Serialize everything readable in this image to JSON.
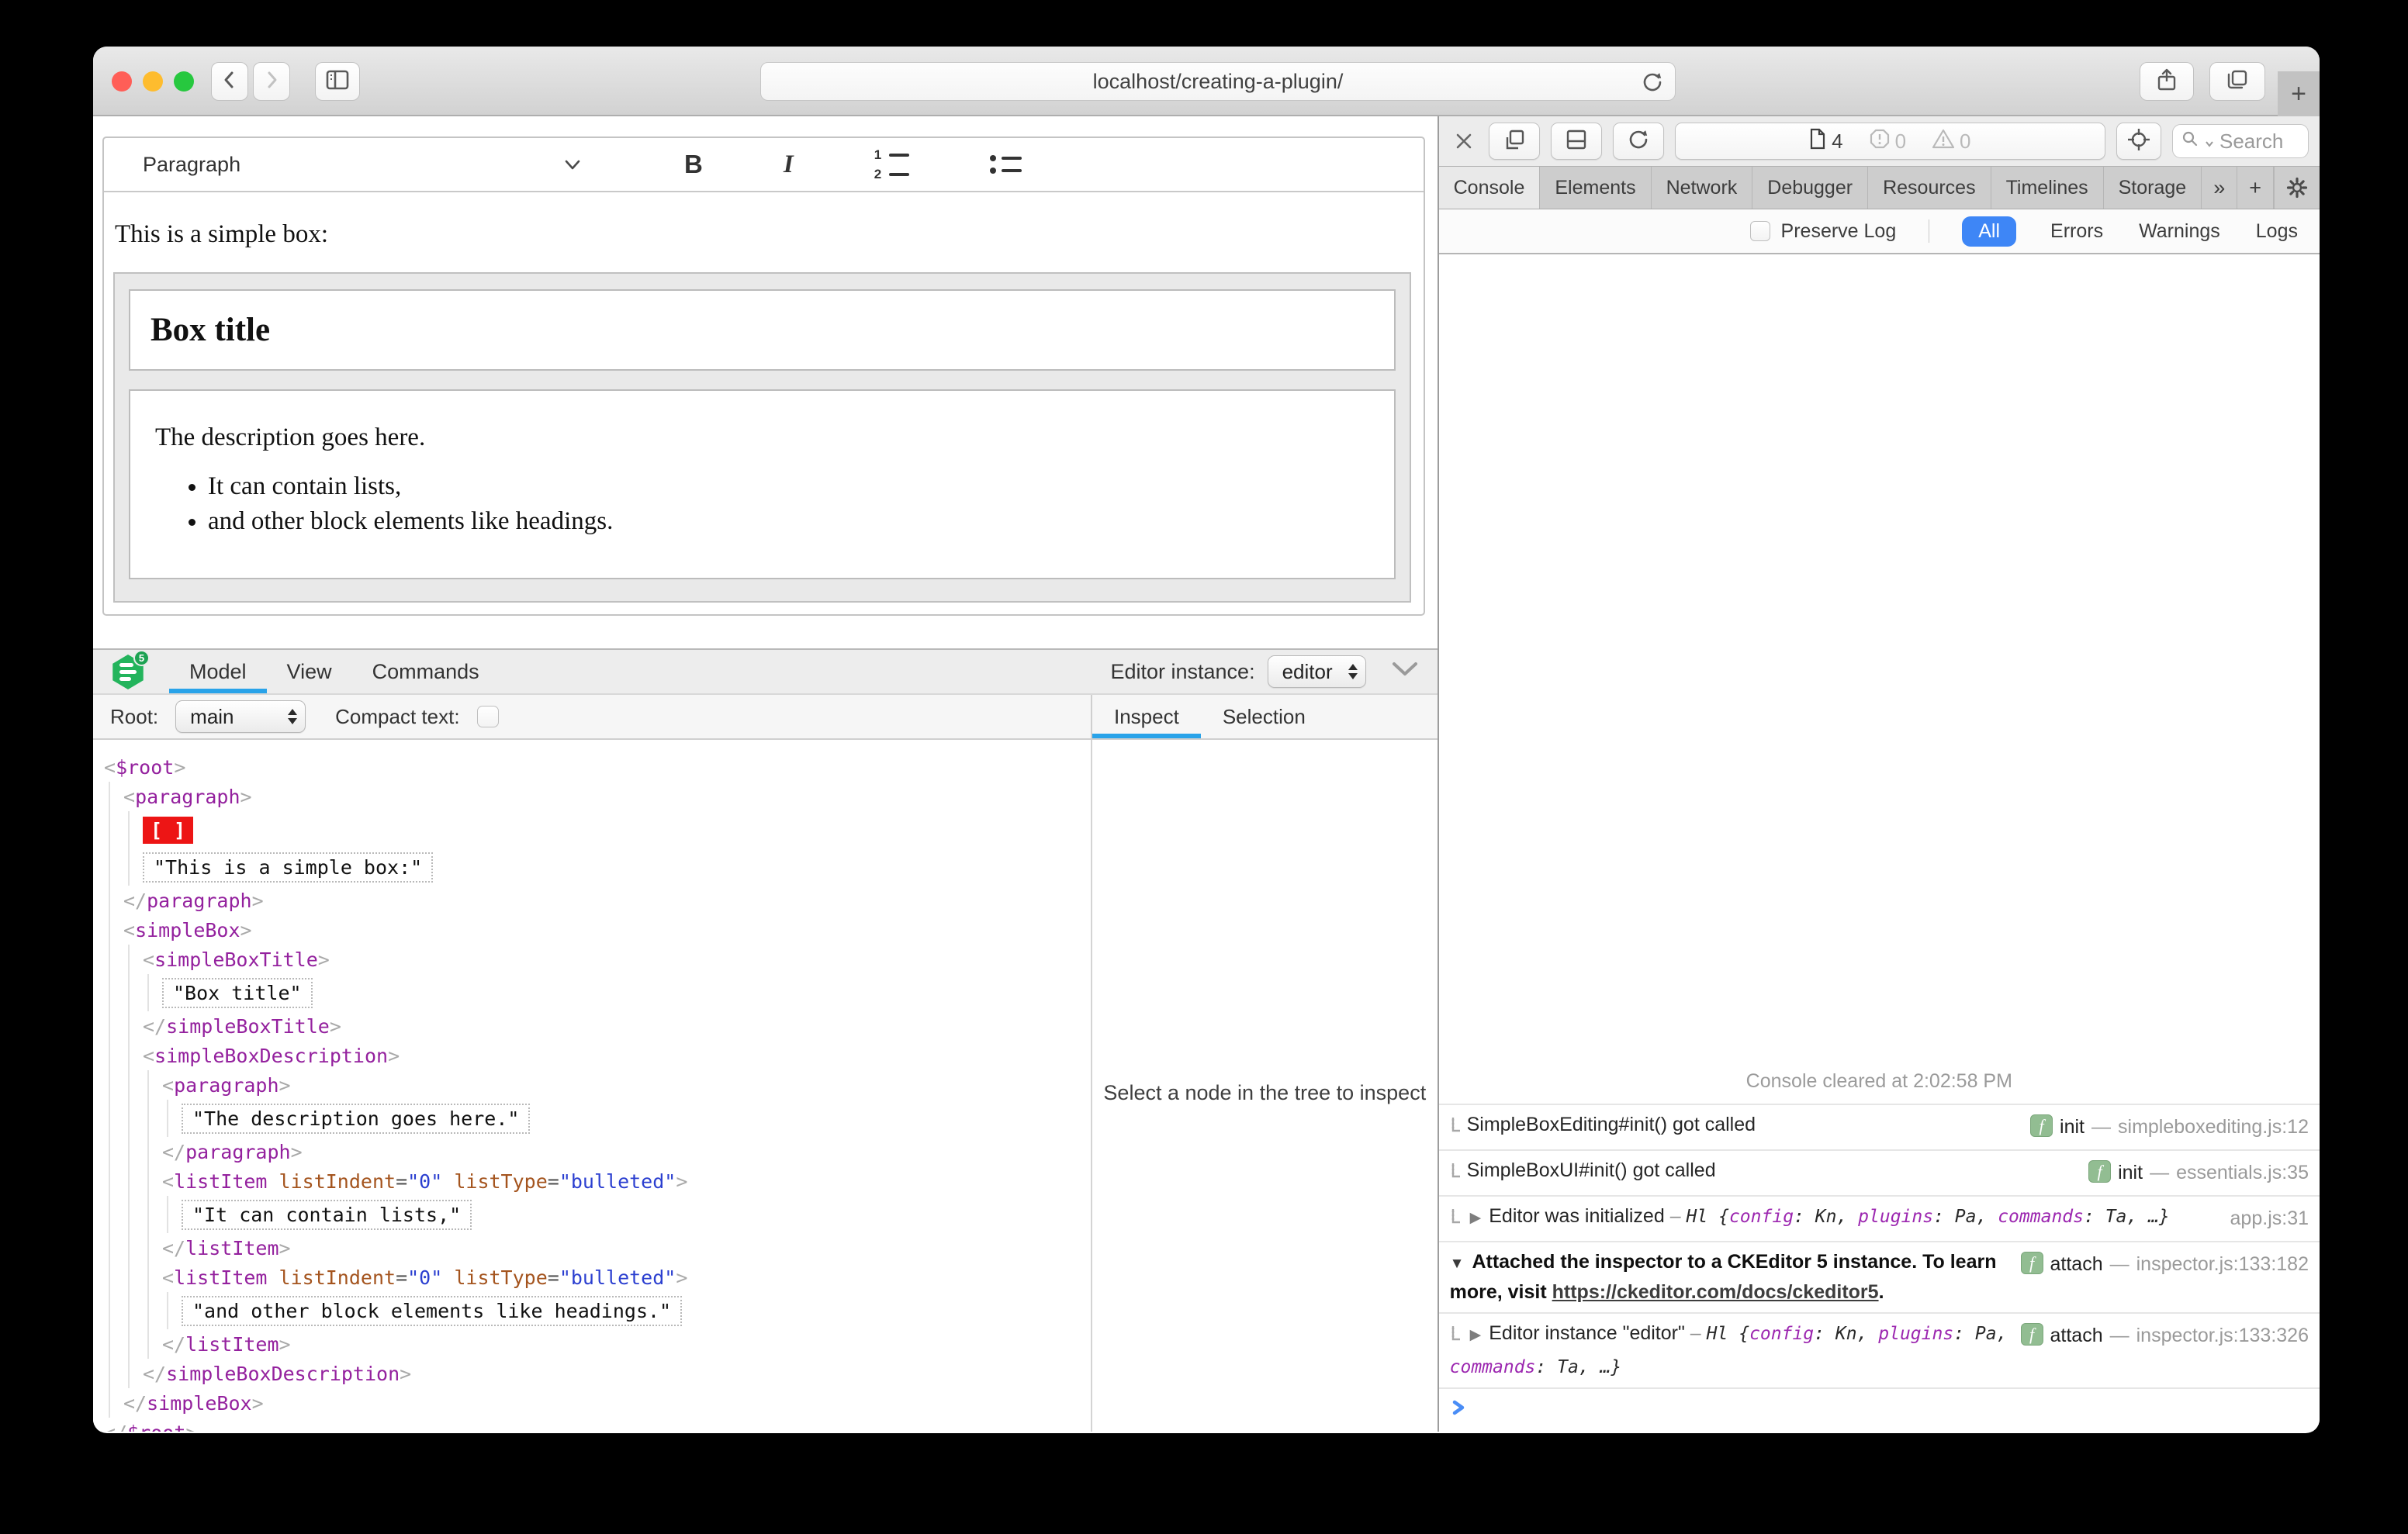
{
  "browser": {
    "url": "localhost/creating-a-plugin/"
  },
  "editor": {
    "toolbar": {
      "paragraph_label": "Paragraph",
      "bold_label": "B",
      "italic_label": "I"
    },
    "content": {
      "intro": "This is a simple box:",
      "box_title": "Box title",
      "box_description": "The description goes here.",
      "box_list": [
        "It can contain lists,",
        "and other block elements like headings."
      ]
    }
  },
  "inspector": {
    "logo_badge": "5",
    "tabs": [
      {
        "label": "Model",
        "active": true
      },
      {
        "label": "View",
        "active": false
      },
      {
        "label": "Commands",
        "active": false
      }
    ],
    "editor_instance_label": "Editor instance:",
    "editor_instance_value": "editor",
    "root_label": "Root:",
    "root_value": "main",
    "compact_text_label": "Compact text:",
    "pane_tabs": [
      {
        "label": "Inspect",
        "active": true
      },
      {
        "label": "Selection",
        "active": false
      }
    ],
    "empty_message": "Select a node in the tree to inspect",
    "tree": [
      {
        "indent": 0,
        "type": "open",
        "tag": "$root"
      },
      {
        "indent": 1,
        "type": "open",
        "tag": "paragraph"
      },
      {
        "indent": 2,
        "type": "selection",
        "text": "[ ]"
      },
      {
        "indent": 2,
        "type": "string",
        "text": "\"This is a simple box:\""
      },
      {
        "indent": 1,
        "type": "close",
        "tag": "paragraph"
      },
      {
        "indent": 1,
        "type": "open",
        "tag": "simpleBox"
      },
      {
        "indent": 2,
        "type": "open",
        "tag": "simpleBoxTitle"
      },
      {
        "indent": 3,
        "type": "string",
        "text": "\"Box title\""
      },
      {
        "indent": 2,
        "type": "close",
        "tag": "simpleBoxTitle"
      },
      {
        "indent": 2,
        "type": "open",
        "tag": "simpleBoxDescription"
      },
      {
        "indent": 3,
        "type": "open",
        "tag": "paragraph"
      },
      {
        "indent": 4,
        "type": "string",
        "text": "\"The description goes here.\""
      },
      {
        "indent": 3,
        "type": "close",
        "tag": "paragraph"
      },
      {
        "indent": 3,
        "type": "open",
        "tag": "listItem",
        "attrs": [
          {
            "name": "listIndent",
            "value": "\"0\""
          },
          {
            "name": "listType",
            "value": "\"bulleted\""
          }
        ]
      },
      {
        "indent": 4,
        "type": "string",
        "text": "\"It can contain lists,\""
      },
      {
        "indent": 3,
        "type": "close",
        "tag": "listItem"
      },
      {
        "indent": 3,
        "type": "open",
        "tag": "listItem",
        "attrs": [
          {
            "name": "listIndent",
            "value": "\"0\""
          },
          {
            "name": "listType",
            "value": "\"bulleted\""
          }
        ]
      },
      {
        "indent": 4,
        "type": "string",
        "text": "\"and other block elements like headings.\""
      },
      {
        "indent": 3,
        "type": "close",
        "tag": "listItem"
      },
      {
        "indent": 2,
        "type": "close",
        "tag": "simpleBoxDescription"
      },
      {
        "indent": 1,
        "type": "close",
        "tag": "simpleBox"
      },
      {
        "indent": 0,
        "type": "close",
        "tag": "$root"
      }
    ]
  },
  "devtools": {
    "toolbar": {
      "resource_count": "4",
      "error_count": "0",
      "warning_count": "0",
      "search_placeholder": "Search"
    },
    "tabs": [
      {
        "label": "Console",
        "active": true
      },
      {
        "label": "Elements"
      },
      {
        "label": "Network"
      },
      {
        "label": "Debugger"
      },
      {
        "label": "Resources"
      },
      {
        "label": "Timelines"
      },
      {
        "label": "Storage"
      },
      {
        "label": "»",
        "icon": "overflow-chevrons-icon"
      },
      {
        "label": "+",
        "icon": "new-tab-icon"
      },
      {
        "label": "",
        "icon": "settings-gear-icon"
      }
    ],
    "filter": {
      "preserve_log_label": "Preserve Log",
      "scopes": [
        {
          "label": "All",
          "active": true
        },
        {
          "label": "Errors"
        },
        {
          "label": "Warnings"
        },
        {
          "label": "Logs"
        }
      ]
    },
    "console": {
      "cleared_message": "Console cleared at 2:02:58 PM",
      "rows": [
        {
          "icon": true,
          "arrow": null,
          "badge": "init",
          "source": "simpleboxediting.js:12",
          "parts": [
            {
              "text": "SimpleBoxEditing#init() got called",
              "style": "plain"
            }
          ]
        },
        {
          "icon": true,
          "arrow": null,
          "badge": "init",
          "source": "essentials.js:35",
          "parts": [
            {
              "text": "SimpleBoxUI#init() got called",
              "style": "plain"
            }
          ]
        },
        {
          "icon": true,
          "arrow": "right",
          "badge": null,
          "source": "app.js:31",
          "parts": [
            {
              "text": "Editor was initialized",
              "style": "plain"
            },
            {
              "text": " – ",
              "style": "dim"
            },
            {
              "text": "Hl ",
              "style": "obj"
            },
            {
              "text": "{",
              "style": "obj"
            },
            {
              "text": "config",
              "style": "prop"
            },
            {
              "text": ": ",
              "style": "obj"
            },
            {
              "text": "Kn",
              "style": "val"
            },
            {
              "text": ", ",
              "style": "obj"
            },
            {
              "text": "plugins",
              "style": "prop"
            },
            {
              "text": ": ",
              "style": "obj"
            },
            {
              "text": "Pa",
              "style": "val"
            },
            {
              "text": ", ",
              "style": "obj"
            },
            {
              "text": "commands",
              "style": "prop"
            },
            {
              "text": ": ",
              "style": "obj"
            },
            {
              "text": "Ta",
              "style": "val"
            },
            {
              "text": ", …}",
              "style": "obj"
            }
          ]
        },
        {
          "icon": false,
          "arrow": "down",
          "badge": "attach",
          "source": "inspector.js:133:182",
          "parts": [
            {
              "text": "Attached the inspector to a CKEditor 5 instance. To learn more, visit ",
              "style": "bold"
            },
            {
              "text": "https://ckeditor.com/docs/ckeditor5",
              "style": "link"
            },
            {
              "text": ".",
              "style": "bold"
            }
          ]
        },
        {
          "icon": true,
          "arrow": "right",
          "badge": "attach",
          "source": "inspector.js:133:326",
          "parts": [
            {
              "text": "Editor instance \"editor\"",
              "style": "plain"
            },
            {
              "text": " – ",
              "style": "dim"
            },
            {
              "text": "Hl ",
              "style": "obj"
            },
            {
              "text": "{",
              "style": "obj"
            },
            {
              "text": "config",
              "style": "prop"
            },
            {
              "text": ": ",
              "style": "obj"
            },
            {
              "text": "Kn",
              "style": "val"
            },
            {
              "text": ", ",
              "style": "obj"
            },
            {
              "text": "plugins",
              "style": "prop"
            },
            {
              "text": ": ",
              "style": "obj"
            },
            {
              "text": "Pa",
              "style": "val"
            },
            {
              "text": ", ",
              "style": "obj"
            },
            {
              "text": "commands",
              "style": "prop"
            },
            {
              "text": ": ",
              "style": "obj"
            },
            {
              "text": "Ta",
              "style": "val"
            },
            {
              "text": ", …}",
              "style": "obj"
            }
          ]
        }
      ]
    }
  }
}
